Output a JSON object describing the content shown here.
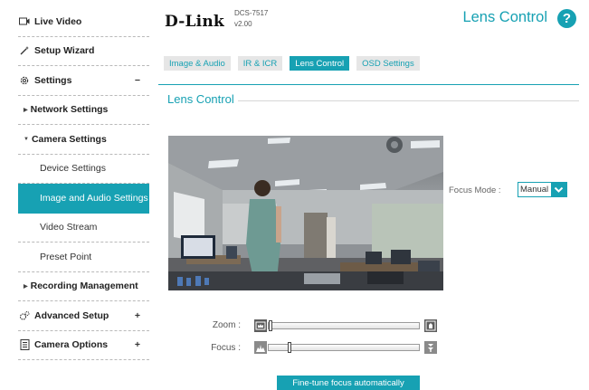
{
  "sidebar": {
    "items": [
      {
        "label": "Live Video"
      },
      {
        "label": "Setup Wizard"
      },
      {
        "label": "Settings",
        "toggle": "−"
      },
      {
        "label": "Network Settings"
      },
      {
        "label": "Camera Settings"
      },
      {
        "label": "Device Settings"
      },
      {
        "label": "Image and Audio Settings"
      },
      {
        "label": "Video Stream"
      },
      {
        "label": "Preset Point"
      },
      {
        "label": "Recording Management"
      },
      {
        "label": "Advanced Setup",
        "toggle": "+"
      },
      {
        "label": "Camera Options",
        "toggle": "+"
      }
    ]
  },
  "header": {
    "logo": "D-Link",
    "model": "DCS-7517",
    "version": "v2.00",
    "page_title": "Lens Control",
    "help": "?"
  },
  "tabs": [
    "Image & Audio",
    "IR & ICR",
    "Lens Control",
    "OSD Settings"
  ],
  "section_title": "Lens Control",
  "focus_mode": {
    "label": "Focus Mode :",
    "value": "Manual"
  },
  "zoom": {
    "label": "Zoom :",
    "level": 0.0
  },
  "focus": {
    "label": "Focus :",
    "level": 0.13
  },
  "fine_tune_label": "Fine-tune focus automatically",
  "colors": {
    "accent": "#17a1b3"
  }
}
